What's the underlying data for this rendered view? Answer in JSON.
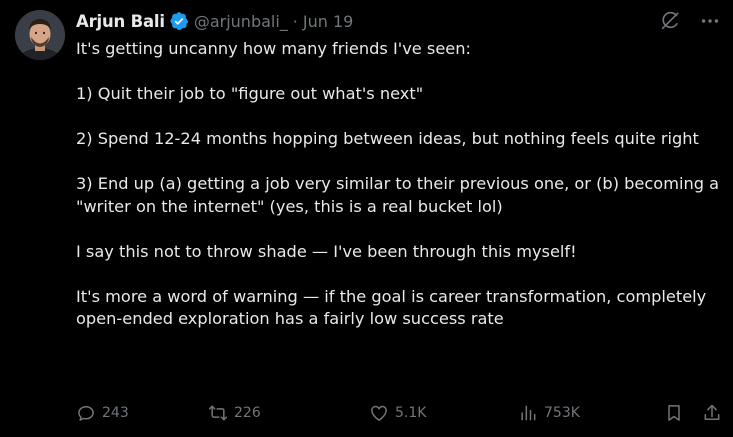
{
  "tweet": {
    "author": {
      "display_name": "Arjun Bali",
      "handle": "@arjunbali_",
      "verified": true
    },
    "separator": "·",
    "date": "Jun 19",
    "paragraphs": [
      "It's getting uncanny how many friends I've seen:",
      "1) Quit their job to \"figure out what's next\"",
      "2) Spend 12-24 months hopping between ideas, but nothing feels quite right",
      "3) End up (a) getting a job very similar to their previous one, or (b) becoming a \"writer on the internet\" (yes, this is a real bucket lol)",
      "I say this not to throw shade — I've been through this myself!",
      "It's more a word of warning — if the goal is career transformation, completely open-ended exploration has a fairly low success rate"
    ],
    "stats": {
      "replies": "243",
      "retweets": "226",
      "likes": "5.1K",
      "views": "753K"
    },
    "top_icons": [
      "grok-icon",
      "more-icon"
    ],
    "action_icons": [
      "reply-icon",
      "retweet-icon",
      "like-icon",
      "views-icon",
      "bookmark-icon",
      "share-icon"
    ]
  },
  "colors": {
    "background": "#000000",
    "text": "#e7e9ea",
    "muted": "#71767b",
    "verified": "#1d9bf0"
  }
}
